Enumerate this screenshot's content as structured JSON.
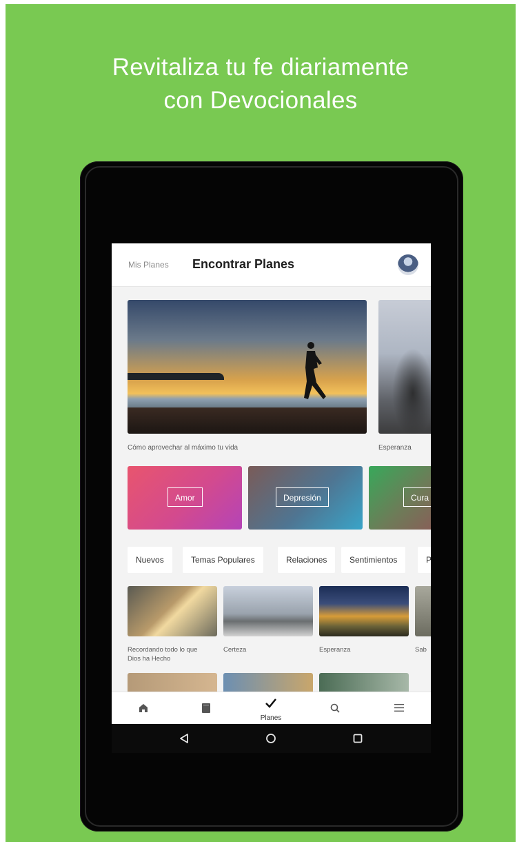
{
  "headline": {
    "line1": "Revitaliza tu fe diariamente",
    "line2": "con Devocionales"
  },
  "header": {
    "tab_my_plans": "Mis Planes",
    "tab_find_plans": "Encontrar Planes",
    "avatar_icon": "avatar"
  },
  "featured": [
    {
      "caption": "Cómo aprovechar al máximo tu vida"
    },
    {
      "caption": "Esperanza"
    }
  ],
  "topics": [
    {
      "label": "Amor"
    },
    {
      "label": "Depresión"
    },
    {
      "label": "Cura"
    }
  ],
  "chips": [
    {
      "label": "Nuevos"
    },
    {
      "label": "Temas Populares"
    },
    {
      "label": "Relaciones"
    },
    {
      "label": "Sentimientos"
    },
    {
      "label": "P"
    }
  ],
  "plans": [
    {
      "caption": "Recordando todo lo que Dios ha Hecho"
    },
    {
      "caption": "Certeza"
    },
    {
      "caption": "Esperanza"
    },
    {
      "caption": "Sab"
    }
  ],
  "bottom_nav": {
    "items": [
      {
        "icon": "home-icon"
      },
      {
        "icon": "book-icon"
      },
      {
        "icon": "check-icon",
        "label": "Planes",
        "active": true
      },
      {
        "icon": "search-icon"
      },
      {
        "icon": "menu-icon"
      }
    ]
  },
  "system_nav": [
    "back-icon",
    "home-circle-icon",
    "recents-icon"
  ],
  "colors": {
    "background": "#79c952",
    "device": "#050505",
    "screen": "#f3f3f3"
  }
}
